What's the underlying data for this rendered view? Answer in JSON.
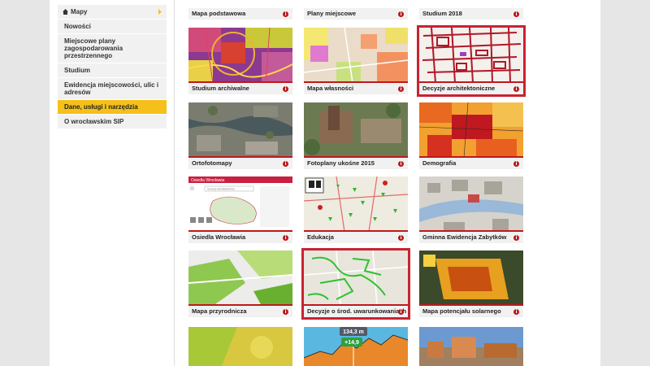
{
  "sidebar": {
    "items": [
      {
        "label": "Mapy"
      },
      {
        "label": "Nowości"
      },
      {
        "label": "Miejscowe plany zagospodarowania przestrzennego"
      },
      {
        "label": "Studium"
      },
      {
        "label": "Ewidencja miejscowości, ulic i adresów"
      },
      {
        "label": "Dane, usługi i narzędzia"
      },
      {
        "label": "O wrocławskim SIP"
      }
    ]
  },
  "tiles": {
    "mapa_podstawowa": "Mapa podstawowa",
    "plany_miejscowe": "Plany miejscowe",
    "studium_2018": "Studium 2018",
    "studium_archiwalne": "Studium archiwalne",
    "mapa_wlasnosci": "Mapa własności",
    "decyzje_arch": "Decyzje architektoniczne",
    "ortofotomapy": "Ortofotomapy",
    "fotoplany": "Fotoplany ukośne 2015",
    "demografia": "Demografia",
    "osiedla": "Osiedla Wrocławia",
    "edukacja": "Edukacja",
    "gez": "Gminna Ewidencja Zabytków",
    "przyrodnicza": "Mapa przyrodnicza",
    "decyzje_srod": "Decyzje o środ. uwarunkowaniach",
    "solarna": "Mapa potencjału solarnego"
  },
  "info_glyph": "i",
  "osiedla_thumb": {
    "title": "Osiedla Wrocławia",
    "search": "Szukaj osiedla/adresu"
  },
  "elevation": {
    "value": "134,3 m",
    "delta": "+14,9"
  }
}
